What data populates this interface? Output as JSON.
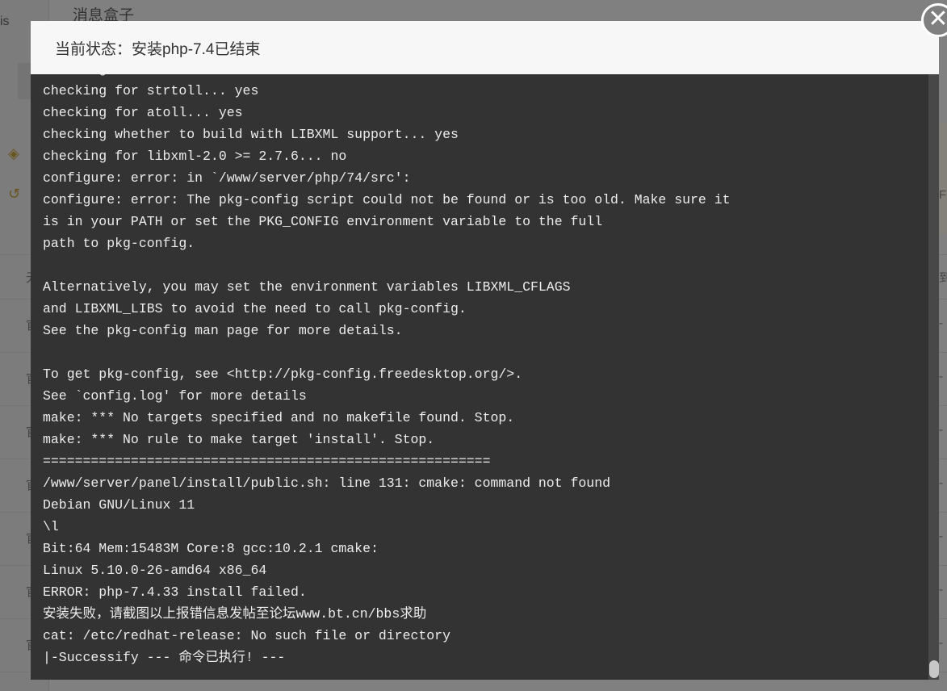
{
  "background": {
    "sidebar_text": "is",
    "page_title": "消息盒子",
    "enterprise_icon": "enterprise-diamond-icon",
    "history_icon": "history-bolt-icon",
    "table_header_left": "无",
    "table_header_right": "到",
    "row_marker_right": "F",
    "row_labels": [
      "官",
      "官",
      "官",
      "官",
      "官",
      "官",
      "官"
    ],
    "row_values": [
      "-",
      "-",
      "-",
      "-",
      "-",
      "-",
      "-"
    ]
  },
  "modal": {
    "title": "当前状态：安装php-7.4已结束",
    "close_icon": "close-circle-icon",
    "log_lines": [
      "checking for ioth... no",
      "checking for strtoll... yes",
      "checking for atoll... yes",
      "checking whether to build with LIBXML support... yes",
      "checking for libxml-2.0 >= 2.7.6... no",
      "configure: error: in `/www/server/php/74/src':",
      "configure: error: The pkg-config script could not be found or is too old. Make sure it",
      "is in your PATH or set the PKG_CONFIG environment variable to the full",
      "path to pkg-config.",
      "",
      "Alternatively, you may set the environment variables LIBXML_CFLAGS",
      "and LIBXML_LIBS to avoid the need to call pkg-config.",
      "See the pkg-config man page for more details.",
      "",
      "To get pkg-config, see <http://pkg-config.freedesktop.org/>.",
      "See `config.log' for more details",
      "make: *** No targets specified and no makefile found. Stop.",
      "make: *** No rule to make target 'install'. Stop.",
      "========================================================",
      "/www/server/panel/install/public.sh: line 131: cmake: command not found",
      "Debian GNU/Linux 11",
      "\\l",
      "Bit:64 Mem:15483M Core:8 gcc:10.2.1 cmake:",
      "Linux 5.10.0-26-amd64 x86_64",
      "ERROR: php-7.4.33 install failed.",
      "安装失败，请截图以上报错信息发帖至论坛www.bt.cn/bbs求助",
      "cat: /etc/redhat-release: No such file or directory",
      "|-Successify --- 命令已执行! ---"
    ]
  }
}
